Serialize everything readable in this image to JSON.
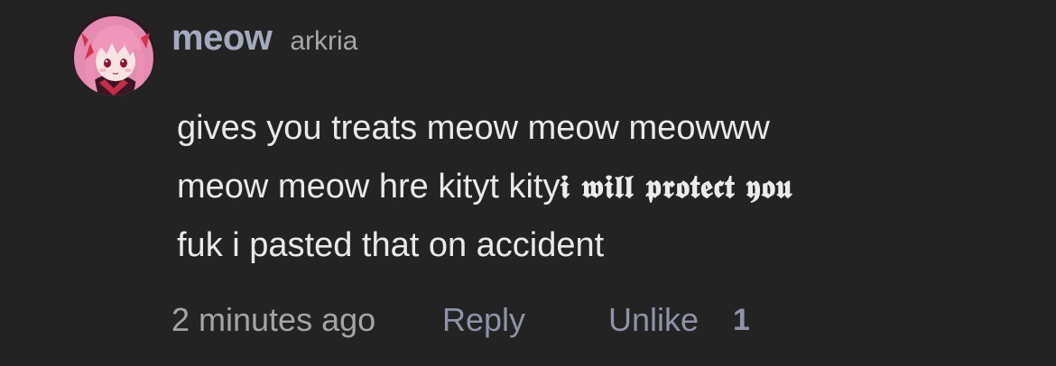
{
  "comment": {
    "avatar_icon": "anime-avatar",
    "display_name": "meow",
    "username": "arkria",
    "body": {
      "line1": "gives you treats meow meow meowww",
      "line2_plain": "meow meow hre kityt kity",
      "line2_gothic": "𝖎 𝖜𝖎𝖑𝖑 𝖕𝖗𝖔𝖙𝖊𝖈𝖙 𝖞𝖔𝖚",
      "line3": "fuk i pasted that on accident"
    },
    "footer": {
      "timestamp": "2 minutes ago",
      "reply_label": "Reply",
      "unlike_label": "Unlike",
      "like_count": "1"
    }
  },
  "colors": {
    "background": "#232324",
    "display_name": "#a4aabd",
    "body_text": "#e9e9ea",
    "action": "#8f93a8"
  }
}
